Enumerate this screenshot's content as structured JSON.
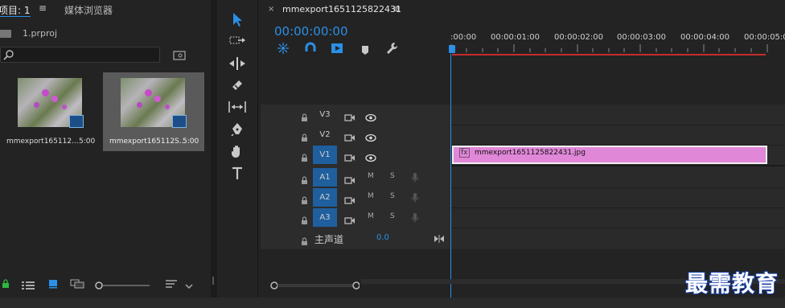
{
  "project_panel": {
    "tab_project": "项目: 1",
    "tab_media_browser": "媒体浏览器",
    "project_file": "1.prproj",
    "search_placeholder": "",
    "items": [
      {
        "name": "mmexport165112...",
        "duration": "5:00",
        "selected": false
      },
      {
        "name": "mmexport165112S...",
        "duration": "5:00",
        "selected": true
      }
    ]
  },
  "tools": [
    "selection-tool",
    "track-select-tool",
    "ripple-edit-tool",
    "razor-tool",
    "slip-tool",
    "pen-tool",
    "hand-tool",
    "type-tool"
  ],
  "timeline": {
    "sequence_name": "mmexport1651125822431",
    "timecode": "00:00:00:00",
    "ruler_labels": [
      ":00:00",
      "00:00:01:00",
      "00:00:02:00",
      "00:00:03:00",
      "00:00:04:00",
      "00:00:05:00"
    ],
    "tracks": [
      {
        "label": "V3",
        "type": "video",
        "targeted": false
      },
      {
        "label": "V2",
        "type": "video",
        "targeted": false
      },
      {
        "label": "V1",
        "type": "video",
        "targeted": true
      },
      {
        "label": "A1",
        "type": "audio",
        "targeted": true
      },
      {
        "label": "A2",
        "type": "audio",
        "targeted": true
      },
      {
        "label": "A3",
        "type": "audio",
        "targeted": true
      }
    ],
    "mute_label": "M",
    "solo_label": "S",
    "master_label": "主声道",
    "master_value": "0.0",
    "clip": {
      "fx": "fx",
      "name": "mmexport1651125822431.jpg"
    }
  },
  "watermark": "最需教育",
  "colors": {
    "accent": "#2b8fe6",
    "clip": "#e087d8",
    "playhead_line": "#c62d2d",
    "track_target": "#1f5f9e"
  }
}
